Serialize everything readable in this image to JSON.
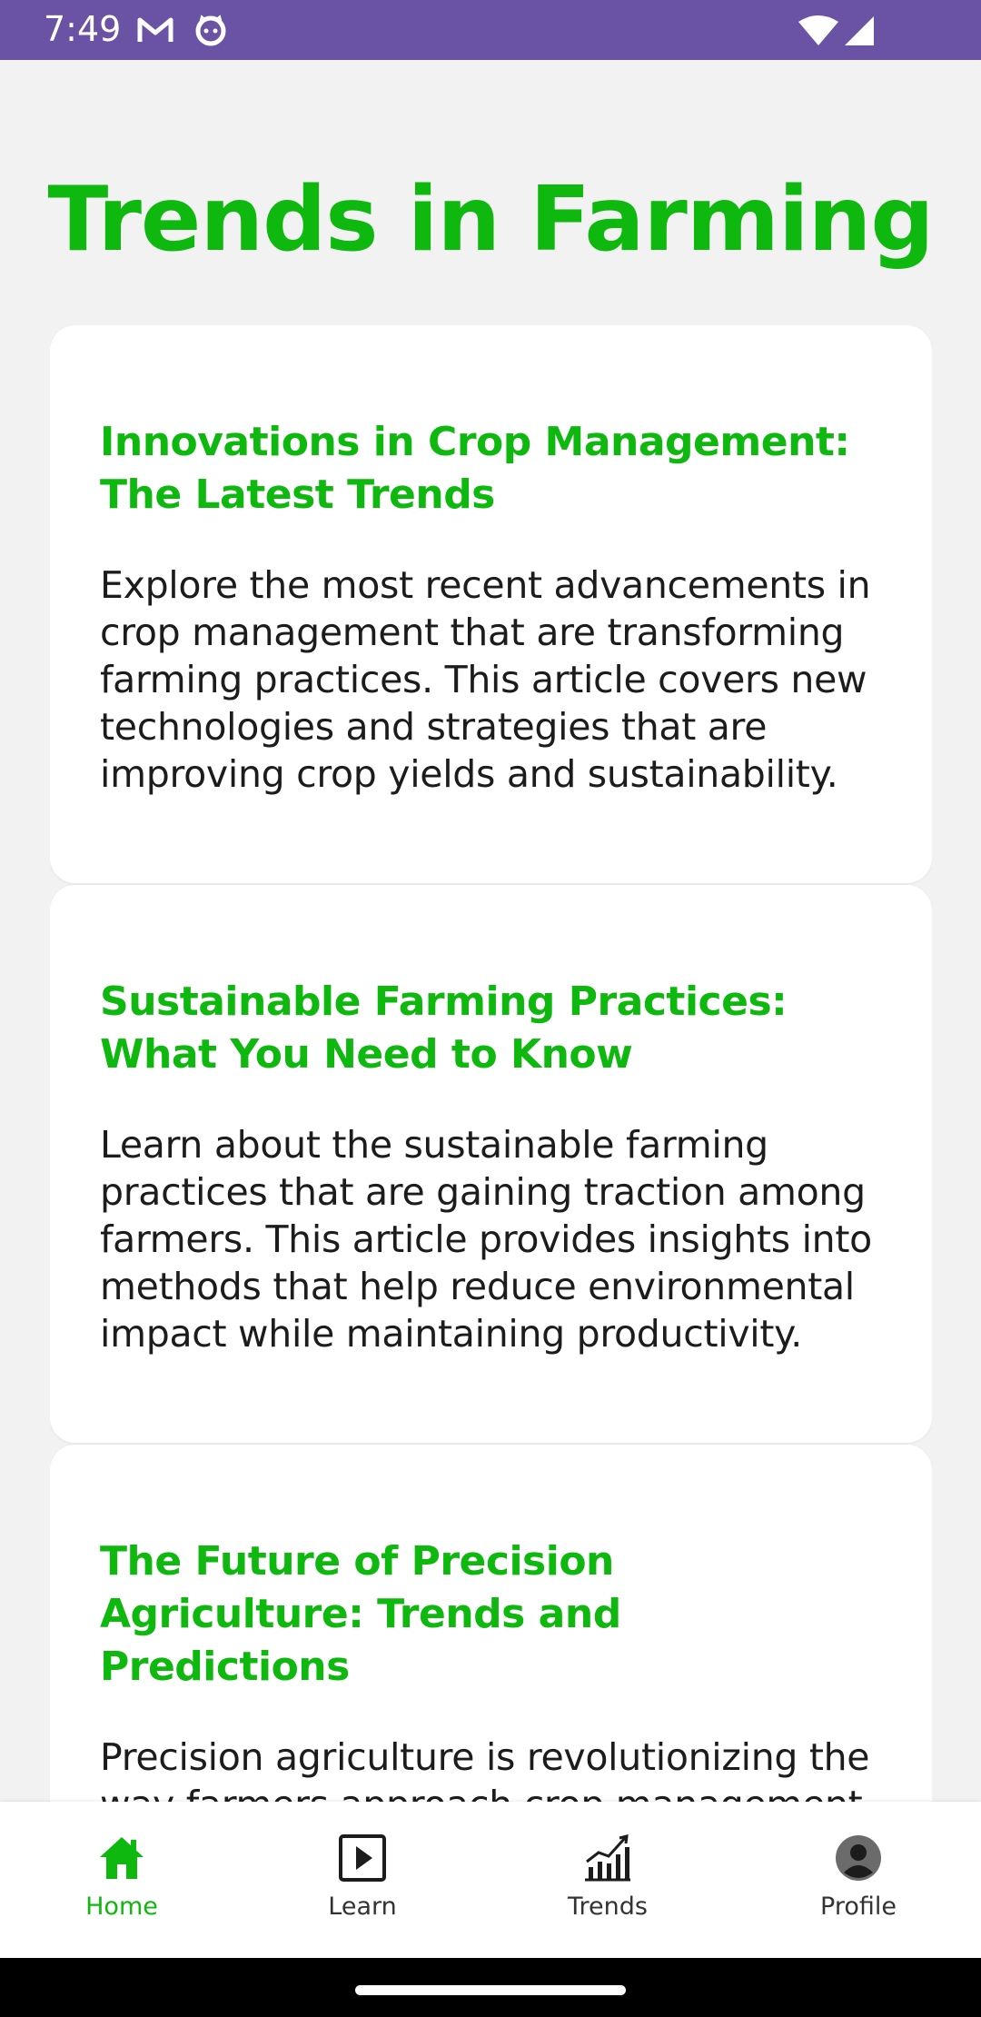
{
  "status_bar": {
    "time": "7:49",
    "left_icons": [
      "gmail-icon",
      "cat-face-icon"
    ],
    "right_icons": [
      "wifi-icon",
      "signal-icon"
    ],
    "color": "#6a52a5"
  },
  "page": {
    "title": "Trends in Farming",
    "accent_color": "#0fb80f"
  },
  "articles": [
    {
      "title": "Innovations in Crop Management: The Latest Trends",
      "body": "Explore the most recent advancements in crop management that are transforming farming practices. This article covers new technologies and strategies that are improving crop yields and sustainability."
    },
    {
      "title": "Sustainable Farming Practices: What You Need to Know",
      "body": "Learn about the sustainable farming practices that are gaining traction among farmers. This article provides insights into methods that help reduce environmental impact while maintaining productivity."
    },
    {
      "title": "The Future of Precision Agriculture: Trends and Predictions",
      "body": "Precision agriculture is revolutionizing the way farmers approach crop management. This article discusses the latest trends and"
    }
  ],
  "bottom_nav": {
    "items": [
      {
        "label": "Home",
        "icon": "home-icon",
        "active": true
      },
      {
        "label": "Learn",
        "icon": "play-icon",
        "active": false
      },
      {
        "label": "Trends",
        "icon": "chart-icon",
        "active": false
      },
      {
        "label": "Profile",
        "icon": "profile-icon",
        "active": false
      }
    ]
  }
}
